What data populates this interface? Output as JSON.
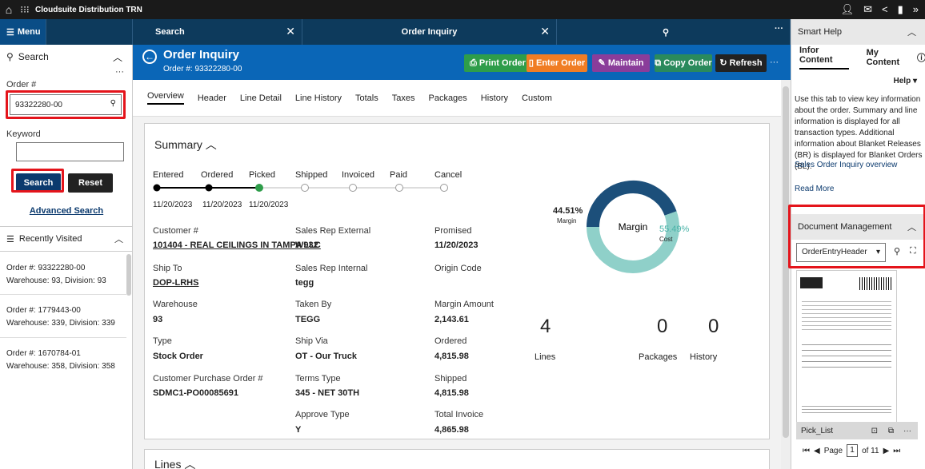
{
  "topbar": {
    "title": "Cloudsuite Distribution TRN"
  },
  "tabs": {
    "menu": "Menu",
    "search": "Search",
    "order_inquiry": "Order Inquiry"
  },
  "left": {
    "search_head": "Search",
    "order_label": "Order #",
    "order_value": "93322280-00",
    "keyword_label": "Keyword",
    "keyword_value": "",
    "search_btn": "Search",
    "reset_btn": "Reset",
    "advanced": "Advanced Search",
    "recent_head": "Recently Visited",
    "recent": [
      {
        "order": "Order #: 93322280-00",
        "wh": "Warehouse: 93, Division: 93"
      },
      {
        "order": "Order #: 1779443-00",
        "wh": "Warehouse: 339, Division: 339"
      },
      {
        "order": "Order #: 1670784-01",
        "wh": "Warehouse: 358, Division: 358"
      }
    ]
  },
  "header": {
    "title": "Order Inquiry",
    "subtitle": "Order #: 93322280-00",
    "buttons": {
      "print": "Print Order",
      "enter": "Enter Order",
      "maintain": "Maintain",
      "copy": "Copy Order",
      "refresh": "Refresh"
    }
  },
  "subtabs": [
    "Overview",
    "Header",
    "Line Detail",
    "Line History",
    "Totals",
    "Taxes",
    "Packages",
    "History",
    "Custom"
  ],
  "summary": {
    "title": "Summary",
    "stages": [
      "Entered",
      "Ordered",
      "Picked",
      "Shipped",
      "Invoiced",
      "Paid",
      "Cancel"
    ],
    "dates": [
      "11/20/2023",
      "11/20/2023",
      "11/20/2023"
    ],
    "fields": {
      "customer_label": "Customer #",
      "customer_value": "101404 - REAL CEILINGS IN TAMPA LLC",
      "shipto_label": "Ship To",
      "shipto_value": "DOP-LRHS",
      "warehouse_label": "Warehouse",
      "warehouse_value": "93",
      "type_label": "Type",
      "type_value": "Stock Order",
      "cpo_label": "Customer Purchase Order #",
      "cpo_value": "SDMC1-PO00085691",
      "srext_label": "Sales Rep External",
      "srext_value": "W932",
      "srint_label": "Sales Rep Internal",
      "srint_value": "tegg",
      "takenby_label": "Taken By",
      "takenby_value": "TEGG",
      "shipvia_label": "Ship Via",
      "shipvia_value": "OT - Our Truck",
      "terms_label": "Terms Type",
      "terms_value": "345 - NET 30TH",
      "approve_label": "Approve Type",
      "approve_value": "Y",
      "promised_label": "Promised",
      "promised_value": "11/20/2023",
      "origin_label": "Origin Code",
      "origin_value": "",
      "margin_label": "Margin Amount",
      "margin_value": "2,143.61",
      "ordered_label": "Ordered",
      "ordered_value": "4,815.98",
      "shipped_label": "Shipped",
      "shipped_value": "4,815.98",
      "invoice_label": "Total Invoice",
      "invoice_value": "4,865.98"
    },
    "donut": {
      "center": "Margin",
      "margin_pct": "44.51%",
      "margin_word": "Margin",
      "cost_pct": "55.49%",
      "cost_word": "Cost",
      "margin_value": 44.51,
      "cost_value": 55.49,
      "margin_color": "#1c4f7a",
      "cost_color": "#8fd0c9"
    },
    "counts": [
      {
        "num": "4",
        "label": "Lines"
      },
      {
        "num": "0",
        "label": "Packages"
      },
      {
        "num": "0",
        "label": "History"
      }
    ],
    "lines_title": "Lines"
  },
  "right": {
    "smart_help": "Smart Help",
    "tab_infor": "Infor Content",
    "tab_my": "My Content",
    "help": "Help",
    "body": "Use this tab to view key information about the order. Summary and line information is displayed for all transaction types. Additional information about Blanket Releases (BR) is displayed for Blanket Orders (BL).",
    "link1": "Sales Order Inquiry overview",
    "link2": "Read More",
    "doc_head": "Document Management",
    "doc_select": "OrderEntryHeader",
    "pick_list": "Pick_List",
    "page_label": "Page",
    "page_num": "1",
    "page_of": "of 11"
  }
}
